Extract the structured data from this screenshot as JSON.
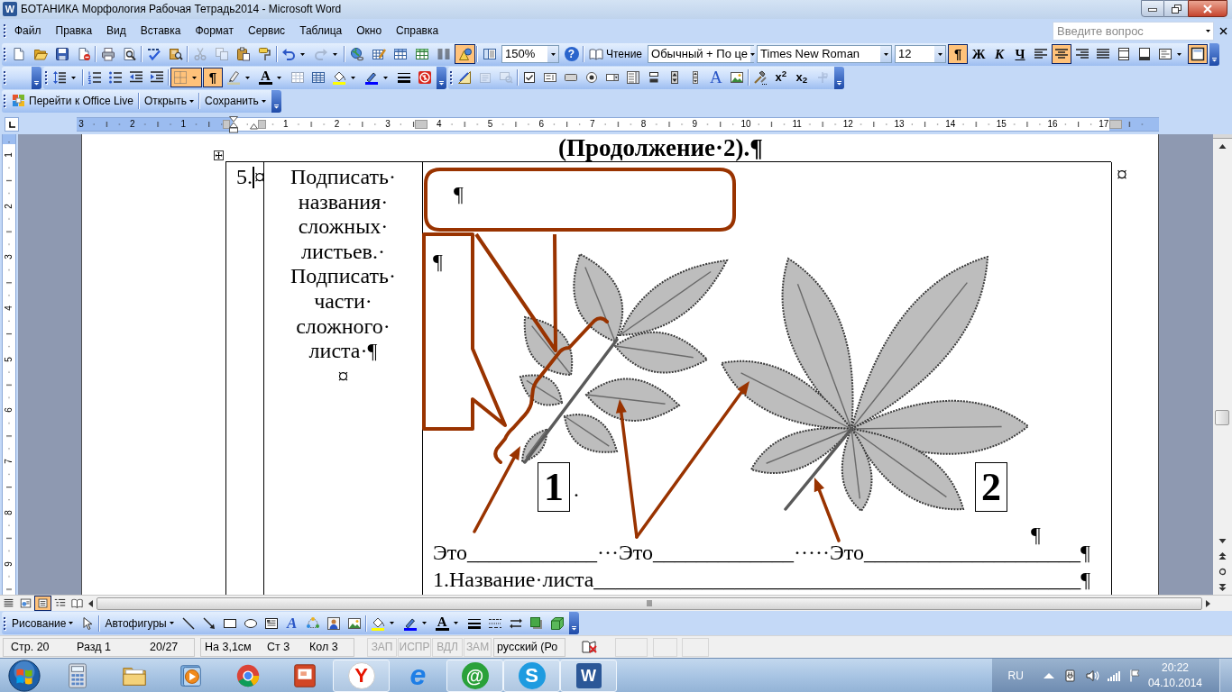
{
  "window": {
    "title": "БОТАНИКА Морфология Рабочая Тетрадь2014 - Microsoft Word",
    "icon_glyph": "W"
  },
  "menu": [
    "Файл",
    "Правка",
    "Вид",
    "Вставка",
    "Формат",
    "Сервис",
    "Таблица",
    "Окно",
    "Справка"
  ],
  "help_box": {
    "placeholder": "Введите вопрос"
  },
  "toolbar_1": [
    {
      "kind": "button",
      "pressed": false,
      "disabled": false
    },
    {
      "kind": "button",
      "pressed": false,
      "disabled": false
    },
    {
      "kind": "button",
      "pressed": false,
      "disabled": false
    },
    {
      "kind": "button",
      "pressed": false,
      "disabled": false
    },
    {
      "kind": "button",
      "pressed": false,
      "disabled": false
    },
    {
      "kind": "button",
      "pressed": false,
      "disabled": false
    },
    {
      "kind": "button",
      "pressed": false,
      "disabled": false
    },
    {
      "kind": "button",
      "pressed": false,
      "disabled": false
    },
    {
      "kind": "button",
      "pressed": false,
      "disabled": true
    },
    {
      "kind": "button",
      "pressed": false,
      "disabled": true
    },
    {
      "kind": "button",
      "pressed": false,
      "disabled": false
    },
    {
      "kind": "button",
      "pressed": false,
      "disabled": false
    },
    {
      "kind": "button",
      "pressed": false,
      "disabled": false
    },
    {
      "kind": "button",
      "pressed": false,
      "disabled": true
    },
    {
      "kind": "button",
      "pressed": false,
      "disabled": false
    },
    {
      "kind": "button",
      "pressed": false,
      "disabled": false
    },
    {
      "kind": "button",
      "pressed": false,
      "disabled": false
    },
    {
      "kind": "button",
      "pressed": false,
      "disabled": false
    },
    {
      "kind": "button",
      "pressed": false,
      "disabled": false
    },
    {
      "kind": "button",
      "pressed": true,
      "disabled": false
    },
    {
      "kind": "button",
      "pressed": false,
      "disabled": false
    },
    {
      "kind": "combo",
      "value": "150%"
    },
    {
      "kind": "glyph",
      "glyph": "?",
      "pressed": false,
      "disabled": false
    },
    {
      "kind": "text",
      "label": "Чтение",
      "menu": false
    },
    {
      "kind": "combo",
      "value": "Обычный + По це"
    },
    {
      "kind": "combo",
      "value": "Times New Roman"
    },
    {
      "kind": "combo",
      "value": "12"
    },
    {
      "kind": "glyph",
      "glyph": "¶",
      "pressed": true,
      "disabled": false
    },
    {
      "kind": "glyph",
      "glyph": "Ж",
      "pressed": false,
      "disabled": false
    },
    {
      "kind": "glyph",
      "glyph": "К",
      "pressed": false,
      "disabled": false
    },
    {
      "kind": "glyph",
      "glyph": "Ч",
      "pressed": false,
      "disabled": false
    },
    {
      "kind": "button",
      "pressed": false,
      "disabled": false
    },
    {
      "kind": "button",
      "pressed": true,
      "disabled": false
    },
    {
      "kind": "button",
      "pressed": false,
      "disabled": false
    },
    {
      "kind": "button",
      "pressed": false,
      "disabled": false
    },
    {
      "kind": "button",
      "pressed": false,
      "disabled": false
    },
    {
      "kind": "button",
      "pressed": false,
      "disabled": false
    },
    {
      "kind": "button",
      "pressed": false,
      "disabled": false
    },
    {
      "kind": "button",
      "pressed": true,
      "disabled": false
    }
  ],
  "toolbar_2": [
    {
      "kind": "button",
      "pressed": false,
      "disabled": false
    },
    {
      "kind": "button",
      "pressed": false,
      "disabled": false
    },
    {
      "kind": "button",
      "pressed": false,
      "disabled": false
    },
    {
      "kind": "button",
      "pressed": false,
      "disabled": false
    },
    {
      "kind": "button",
      "pressed": false,
      "disabled": false
    },
    {
      "kind": "button",
      "pressed": true,
      "disabled": false
    },
    {
      "kind": "glyph",
      "glyph": "¶",
      "pressed": true,
      "disabled": false
    },
    {
      "kind": "button",
      "pressed": false,
      "disabled": false
    },
    {
      "kind": "glyph",
      "glyph": "A",
      "pressed": false,
      "disabled": false
    },
    {
      "kind": "button",
      "pressed": false,
      "disabled": false
    },
    {
      "kind": "button",
      "pressed": false,
      "disabled": false
    },
    {
      "kind": "button",
      "pressed": false,
      "disabled": false
    },
    {
      "kind": "button",
      "pressed": false,
      "disabled": false
    },
    {
      "kind": "button",
      "pressed": false,
      "disabled": false
    },
    {
      "kind": "button",
      "pressed": false,
      "disabled": false
    }
  ],
  "toolbar_3": [
    {
      "kind": "button",
      "pressed": false,
      "disabled": false
    },
    {
      "kind": "button",
      "pressed": false,
      "disabled": true
    },
    {
      "kind": "button",
      "pressed": false,
      "disabled": true
    },
    {
      "kind": "button",
      "pressed": false,
      "disabled": false
    },
    {
      "kind": "button",
      "pressed": false,
      "disabled": false
    },
    {
      "kind": "button",
      "pressed": false,
      "disabled": false
    },
    {
      "kind": "button",
      "pressed": false,
      "disabled": false
    },
    {
      "kind": "button",
      "pressed": false,
      "disabled": false
    },
    {
      "kind": "button",
      "pressed": false,
      "disabled": false
    },
    {
      "kind": "button",
      "pressed": false,
      "disabled": false
    },
    {
      "kind": "button",
      "pressed": false,
      "disabled": false
    },
    {
      "kind": "button",
      "pressed": false,
      "disabled": false
    },
    {
      "kind": "glyph",
      "glyph": "A",
      "pressed": false,
      "disabled": false
    },
    {
      "kind": "button",
      "pressed": false,
      "disabled": false
    },
    {
      "kind": "button",
      "pressed": false,
      "disabled": false
    },
    {
      "kind": "glyph",
      "glyph": "x$^{2}$",
      "pressed": false,
      "disabled": false
    },
    {
      "kind": "glyph",
      "glyph": "x$_{2}$",
      "pressed": false,
      "disabled": false
    },
    {
      "kind": "button",
      "pressed": false,
      "disabled": true
    }
  ],
  "toolbar_4": [
    {
      "kind": "text",
      "label": "Перейти к Office Live",
      "menu": false
    },
    {
      "kind": "text",
      "label": "Открыть",
      "menu": true
    },
    {
      "kind": "text",
      "label": "Сохранить",
      "menu": true
    }
  ],
  "ruler": {
    "left_marks": [
      "3",
      "2",
      "1"
    ],
    "right_marks": [
      "1",
      "2",
      "3",
      "4",
      "5",
      "6",
      "7",
      "8",
      "9",
      "10",
      "11",
      "12",
      "13",
      "14",
      "15",
      "16",
      "17"
    ],
    "vertical_marks": [
      "1",
      "2",
      "3",
      "4",
      "5",
      "6",
      "7",
      "8",
      "9"
    ]
  },
  "document": {
    "heading": "(Продолжение·2).¶",
    "number": "5.",
    "number_cell_mark": "¤",
    "task": "Подписать·названия·сложных·листьев.·Подписать·части·сложного·листа·¶",
    "task_cell_mark": "¤",
    "row_end_mark": "¤",
    "callout_marks": [
      "¶",
      "¶"
    ],
    "figure_labels": [
      "1",
      "2"
    ],
    "label_space_mark": "·",
    "figure_end_mark": "¶",
    "answer_line": "Это____________···Это_____________·····Это____________________¶",
    "name_line": "1.Название·листа_____________________________________________¶"
  },
  "view_buttons": [
    {
      "selected": false
    },
    {
      "selected": false
    },
    {
      "selected": true
    },
    {
      "selected": false
    },
    {
      "selected": false
    }
  ],
  "drawing_toolbar": [
    {
      "kind": "text",
      "label": "Рисование",
      "menu": true
    },
    {
      "kind": "button",
      "pressed": false,
      "disabled": false
    },
    {
      "kind": "text",
      "label": "Автофигуры",
      "menu": true
    },
    {
      "kind": "button",
      "pressed": false,
      "disabled": false
    },
    {
      "kind": "button",
      "pressed": false,
      "disabled": false
    },
    {
      "kind": "button",
      "pressed": false,
      "disabled": false
    },
    {
      "kind": "button",
      "pressed": false,
      "disabled": false
    },
    {
      "kind": "button",
      "pressed": false,
      "disabled": false
    },
    {
      "kind": "glyph",
      "glyph": "A",
      "pressed": false,
      "disabled": false
    },
    {
      "kind": "button",
      "pressed": false,
      "disabled": false
    },
    {
      "kind": "button",
      "pressed": false,
      "disabled": false
    },
    {
      "kind": "button",
      "pressed": false,
      "disabled": false
    },
    {
      "kind": "button",
      "pressed": false,
      "disabled": false
    },
    {
      "kind": "button",
      "pressed": false,
      "disabled": false
    },
    {
      "kind": "glyph",
      "glyph": "A",
      "pressed": false,
      "disabled": false
    },
    {
      "kind": "button",
      "pressed": false,
      "disabled": false
    },
    {
      "kind": "button",
      "pressed": false,
      "disabled": false
    },
    {
      "kind": "button",
      "pressed": false,
      "disabled": false
    },
    {
      "kind": "button",
      "pressed": false,
      "disabled": false
    },
    {
      "kind": "button",
      "pressed": false,
      "disabled": false
    }
  ],
  "status_bar": {
    "fields": [
      "Стр. 20",
      "Разд 1",
      "20/27",
      "На 3,1см",
      "Ст 3",
      "Кол 3"
    ],
    "modes": [
      {
        "label": "ЗАП",
        "on": false
      },
      {
        "label": "ИСПР",
        "on": false
      },
      {
        "label": "ВДЛ",
        "on": false
      },
      {
        "label": "ЗАМ",
        "on": false
      }
    ],
    "language": "русский (Ро"
  },
  "taskbar": {
    "apps": [
      {
        "kind": "icon",
        "running": false
      },
      {
        "kind": "icon",
        "running": false
      },
      {
        "kind": "icon",
        "running": false
      },
      {
        "kind": "icon",
        "running": false
      },
      {
        "kind": "icon",
        "running": false
      },
      {
        "kind": "logo",
        "glyph": "Y",
        "running": true
      },
      {
        "kind": "logo",
        "glyph": "e",
        "running": false
      },
      {
        "kind": "logo",
        "glyph": "@",
        "running": true
      },
      {
        "kind": "logo",
        "glyph": "S",
        "running": true
      },
      {
        "kind": "logo",
        "glyph": "W",
        "running": true
      }
    ],
    "language": "RU",
    "time": "20:22",
    "date": "04.10.2014"
  }
}
